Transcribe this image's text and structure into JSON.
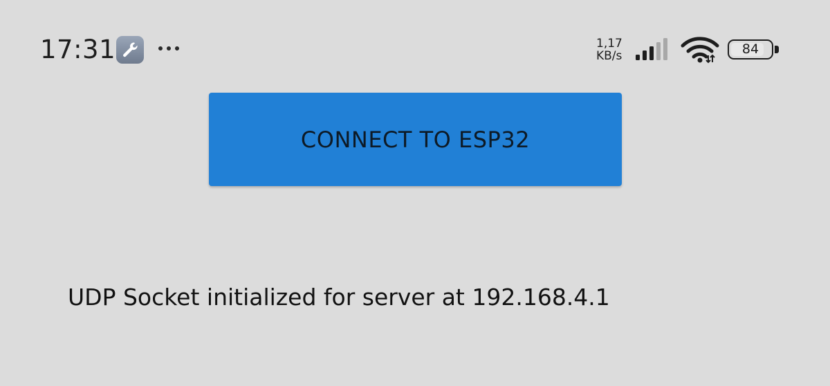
{
  "status_bar": {
    "time": "17:31",
    "notification_icon": "wrench-icon",
    "more_icon": "more-dots-icon",
    "net_speed_value": "1,17",
    "net_speed_unit": "KB/s",
    "signal_icon": "cellular-signal-icon",
    "signal_bars_active": 3,
    "signal_bars_total": 5,
    "wifi_icon": "wifi-icon",
    "battery_level": "84",
    "battery_percent": 84
  },
  "main": {
    "connect_button_label": "CONNECT TO ESP32",
    "status_message": "UDP Socket initialized for server at 192.168.4.1"
  },
  "colors": {
    "background": "#dcdcdc",
    "button": "#2180d6",
    "button_text": "#0d1a26",
    "text": "#111111"
  }
}
